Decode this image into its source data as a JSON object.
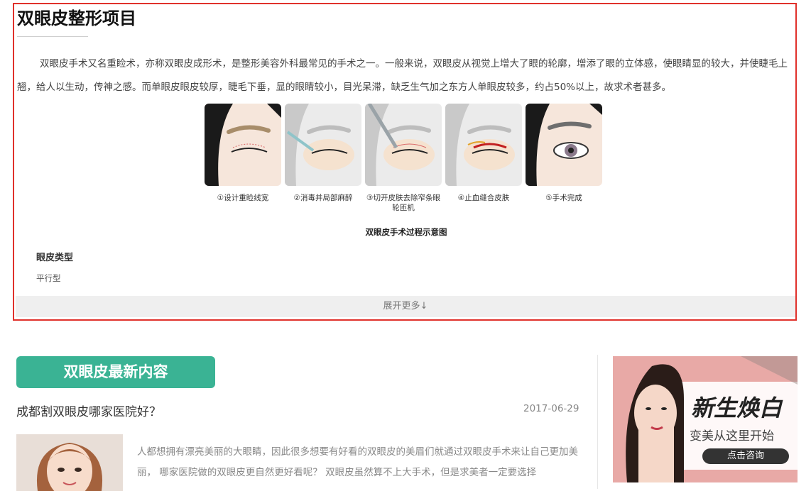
{
  "intro": {
    "title": "双眼皮整形项目",
    "paragraph": "双眼皮手术又名重睑术，亦称双眼皮成形术，是整形美容外科最常见的手术之一。一般来说，双眼皮从视觉上增大了眼的轮廓，增添了眼的立体感，使眼睛显的较大，并使睫毛上翘，给人以生动，传神之感。而单眼皮眼皮较厚，睫毛下垂，显的眼睛较小，目光呆滞，缺乏生气加之东方人单眼皮较多，约占50%以上，故求术者甚多。",
    "steps": [
      {
        "caption": "①设计重睑线宽"
      },
      {
        "caption": "②消毒并局部麻醉"
      },
      {
        "caption": "③切开皮肤去除窄条眼轮匝机"
      },
      {
        "caption": "④止血缝合皮肤"
      },
      {
        "caption": "⑤手术完成"
      }
    ],
    "figure_caption": "双眼皮手术过程示意图",
    "eyelid_heading": "眼皮类型",
    "eyelid_type": "平行型",
    "expand_label": "展开更多↓"
  },
  "latest": {
    "header": "双眼皮最新内容",
    "article": {
      "title": "成都割双眼皮哪家医院好？",
      "date": "2017-06-29",
      "excerpt": "人都想拥有漂亮美丽的大眼睛，因此很多想要有好看的双眼皮的美眉们就通过双眼皮手术来让自己更加美丽， 哪家医院做的双眼皮更自然更好看呢？ 双眼皮虽然算不上大手术，但是求美者一定要选择"
    }
  },
  "ad": {
    "title": "新生焕白",
    "subtitle": "变美从这里开始",
    "button": "点击咨询"
  },
  "colors": {
    "border_accent": "#e0312b",
    "section_green": "#3ab394",
    "ad_pink": "#e8a9a6"
  }
}
